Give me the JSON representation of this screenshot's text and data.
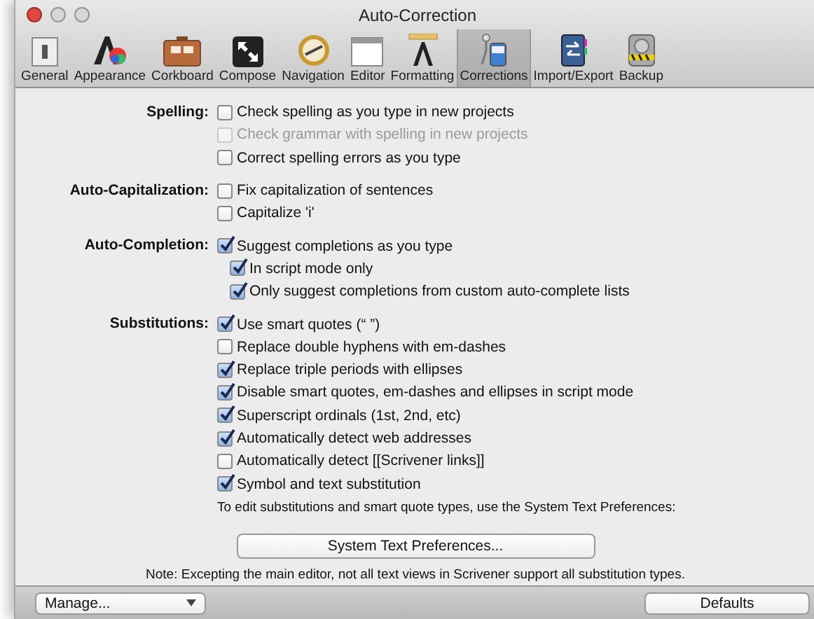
{
  "window": {
    "title": "Auto-Correction"
  },
  "toolbar": [
    {
      "label": "General",
      "selected": false
    },
    {
      "label": "Appearance",
      "selected": false
    },
    {
      "label": "Corkboard",
      "selected": false
    },
    {
      "label": "Compose",
      "selected": false
    },
    {
      "label": "Navigation",
      "selected": false
    },
    {
      "label": "Editor",
      "selected": false
    },
    {
      "label": "Formatting",
      "selected": false
    },
    {
      "label": "Corrections",
      "selected": true
    },
    {
      "label": "Import/Export",
      "selected": false
    },
    {
      "label": "Backup",
      "selected": false
    }
  ],
  "sections": [
    {
      "label": "Spelling:",
      "options": [
        {
          "label": "Check spelling as you type in new projects",
          "checked": false,
          "disabled": false
        },
        {
          "label": "Check grammar with spelling in new projects",
          "checked": false,
          "disabled": true
        },
        {
          "label": "Correct spelling errors as you type",
          "checked": false,
          "disabled": false
        }
      ]
    },
    {
      "label": "Auto-Capitalization:",
      "options": [
        {
          "label": "Fix capitalization of sentences",
          "checked": false,
          "disabled": false
        },
        {
          "label": "Capitalize 'i'",
          "checked": false,
          "disabled": false
        }
      ]
    },
    {
      "label": "Auto-Completion:",
      "options": [
        {
          "label": "Suggest completions as you type",
          "checked": true,
          "disabled": false,
          "children": [
            {
              "label": "In script mode only",
              "checked": true,
              "disabled": false
            },
            {
              "label": "Only suggest completions from custom auto-complete lists",
              "checked": true,
              "disabled": false
            }
          ]
        }
      ]
    },
    {
      "label": "Substitutions:",
      "options": [
        {
          "label": "Use smart quotes (“ ”)",
          "checked": true,
          "disabled": false
        },
        {
          "label": "Replace double hyphens with em-dashes",
          "checked": false,
          "disabled": false
        },
        {
          "label": "Replace triple periods with ellipses",
          "checked": true,
          "disabled": false
        },
        {
          "label": "Disable smart quotes, em-dashes and ellipses in script mode",
          "checked": true,
          "disabled": false
        },
        {
          "label": "Superscript ordinals (1st, 2nd, etc)",
          "checked": true,
          "disabled": false
        },
        {
          "label": "Automatically detect web addresses",
          "checked": true,
          "disabled": false
        },
        {
          "label": "Automatically detect [[Scrivener links]]",
          "checked": false,
          "disabled": false
        },
        {
          "label": "Symbol and text substitution",
          "checked": true,
          "disabled": false
        }
      ],
      "hint": "To edit substitutions and smart quote types, use the System Text Preferences:"
    }
  ],
  "system_button": "System Text Preferences...",
  "note": "Note: Excepting the main editor, not all text views in Scrivener support all substitution types.",
  "footer": {
    "manage": "Manage...",
    "defaults": "Defaults"
  }
}
